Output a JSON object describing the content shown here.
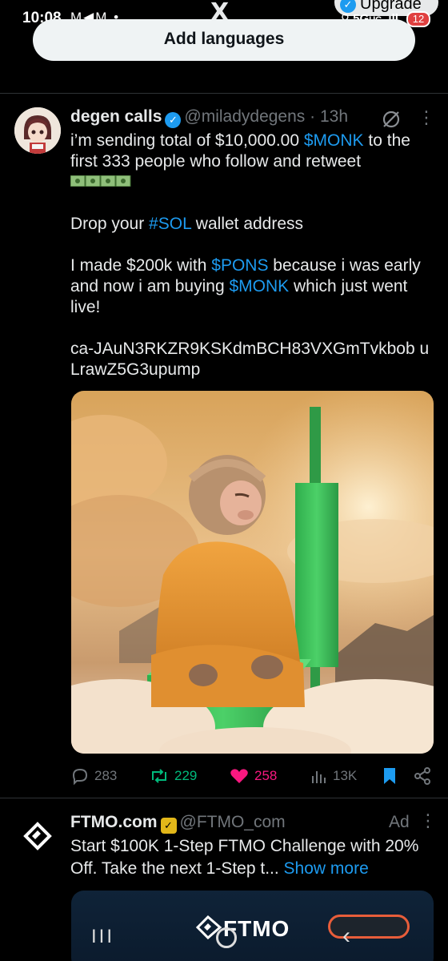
{
  "status_bar": {
    "time": "10:08",
    "left_icons": "M◀M •",
    "network": "5G",
    "network_sub": "UC",
    "battery": "12"
  },
  "header": {
    "logo": "X",
    "upgrade_label": "Upgrade"
  },
  "add_languages_label": "Add languages",
  "tweet": {
    "author_name": "degen calls",
    "handle": "@miladydegens",
    "separator": "·",
    "time_ago": "13h",
    "line1_pre": "i’m sending total of $10,000.00 ",
    "line1_tag": "$MONK",
    "line1_post": " to the first 333 people who follow and retweet",
    "line2_pre": "Drop your ",
    "line2_tag": "#SOL",
    "line2_post": " wallet address",
    "line3_pre": "I made $200k with ",
    "line3_tag1": "$PONS",
    "line3_mid": " because i was early and now i am buying ",
    "line3_tag2": "$MONK",
    "line3_post": " which just went live!",
    "contract": "ca-JAuN3RKZR9KSKdmBCH83VXGmTvkbob uLrawZ5G3upump",
    "stats": {
      "replies": "283",
      "reposts": "229",
      "likes": "258",
      "views": "13K"
    }
  },
  "ad": {
    "author_name": "FTMO.com",
    "handle": "@FTMO_com",
    "ad_label": "Ad",
    "text": "Start $100K 1-Step FTMO Challenge with 20% Off. Take the next 1-Step t... ",
    "show_more": "Show more",
    "wordmark": "FTMO"
  },
  "colors": {
    "accent": "#1d9bf0",
    "repost": "#00ba7c",
    "like": "#f91880",
    "muted": "#71767b",
    "background": "#000000"
  }
}
